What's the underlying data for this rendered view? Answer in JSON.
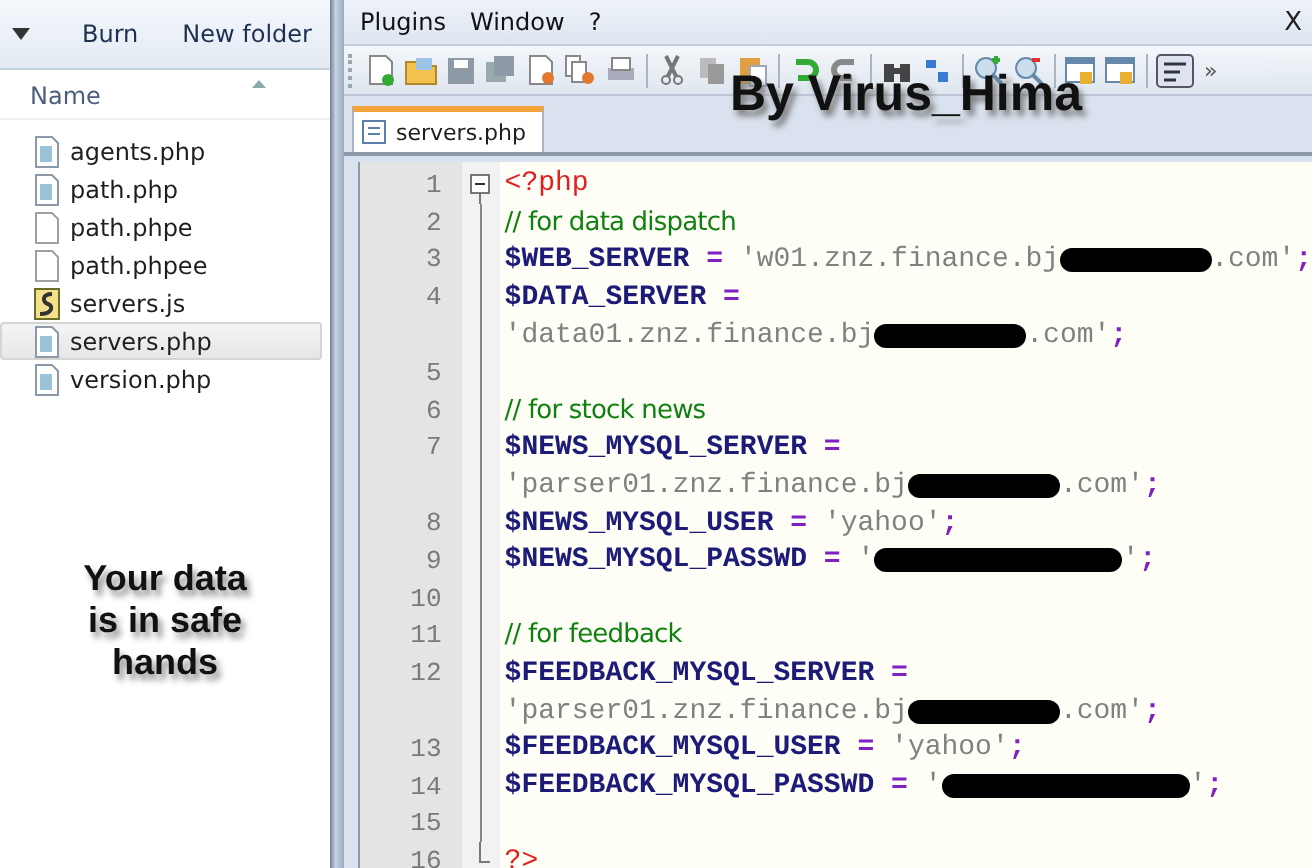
{
  "explorer": {
    "toolbar": [
      "Burn",
      "New folder"
    ],
    "column_header": "Name",
    "files": [
      {
        "name": "agents.php",
        "kind": "php",
        "selected": false
      },
      {
        "name": "path.php",
        "kind": "php",
        "selected": false
      },
      {
        "name": "path.phpe",
        "kind": "blank",
        "selected": false
      },
      {
        "name": "path.phpee",
        "kind": "blank",
        "selected": false
      },
      {
        "name": "servers.js",
        "kind": "script",
        "selected": false
      },
      {
        "name": "servers.php",
        "kind": "php",
        "selected": true
      },
      {
        "name": "version.php",
        "kind": "php",
        "selected": false
      }
    ],
    "caption": "Your data is in safe hands"
  },
  "editor": {
    "menu": [
      "Plugins",
      "Window",
      "?"
    ],
    "close_label": "X",
    "more_label": "»",
    "overlay_caption": "By Virus_Hima",
    "tabs": [
      {
        "label": "servers.php",
        "selected": true
      }
    ],
    "rows": [
      {
        "number": "1",
        "kind": "foldstart",
        "tokens": [
          {
            "kind": "tag",
            "text": "<?php"
          }
        ]
      },
      {
        "number": "2",
        "tokens": [
          {
            "kind": "comment",
            "text": "// for data dispatch"
          }
        ]
      },
      {
        "number": "3",
        "tokens": [
          {
            "kind": "variable",
            "text": "$WEB_SERVER"
          },
          {
            "kind": "operator",
            "text": " = "
          },
          {
            "kind": "string",
            "text": "'w01.znz.finance.bj"
          },
          {
            "kind": "redaction"
          },
          {
            "kind": "string",
            "text": ".com'"
          },
          {
            "kind": "operator",
            "text": ";"
          }
        ]
      },
      {
        "number": "4",
        "tokens": [
          {
            "kind": "variable",
            "text": "$DATA_SERVER"
          },
          {
            "kind": "operator",
            "text": " ="
          }
        ]
      },
      {
        "tokens": [
          {
            "kind": "string",
            "text": "'data01.znz.finance.bj"
          },
          {
            "kind": "redaction"
          },
          {
            "kind": "string",
            "text": ".com'"
          },
          {
            "kind": "operator",
            "text": ";"
          }
        ]
      },
      {
        "number": "5",
        "tokens": []
      },
      {
        "number": "6",
        "tokens": [
          {
            "kind": "comment",
            "text": "// for stock news"
          }
        ]
      },
      {
        "number": "7",
        "tokens": [
          {
            "kind": "variable",
            "text": "$NEWS_MYSQL_SERVER"
          },
          {
            "kind": "operator",
            "text": " ="
          }
        ]
      },
      {
        "tokens": [
          {
            "kind": "string",
            "text": "'parser01.znz.finance.bj"
          },
          {
            "kind": "redaction"
          },
          {
            "kind": "string",
            "text": ".com'"
          },
          {
            "kind": "operator",
            "text": ";"
          }
        ]
      },
      {
        "number": "8",
        "tokens": [
          {
            "kind": "variable",
            "text": "$NEWS_MYSQL_USER"
          },
          {
            "kind": "operator",
            "text": " = "
          },
          {
            "kind": "string",
            "text": "'yahoo'"
          },
          {
            "kind": "operator",
            "text": ";"
          }
        ]
      },
      {
        "number": "9",
        "tokens": [
          {
            "kind": "variable",
            "text": "$NEWS_MYSQL_PASSWD"
          },
          {
            "kind": "operator",
            "text": " = "
          },
          {
            "kind": "string",
            "text": "'"
          },
          {
            "kind": "longredaction"
          },
          {
            "kind": "string",
            "text": "'"
          },
          {
            "kind": "operator",
            "text": ";"
          }
        ]
      },
      {
        "number": "10",
        "tokens": []
      },
      {
        "number": "11",
        "tokens": [
          {
            "kind": "comment",
            "text": "// for feedback"
          }
        ]
      },
      {
        "number": "12",
        "tokens": [
          {
            "kind": "variable",
            "text": "$FEEDBACK_MYSQL_SERVER"
          },
          {
            "kind": "operator",
            "text": " ="
          }
        ]
      },
      {
        "tokens": [
          {
            "kind": "string",
            "text": "'parser01.znz.finance.bj"
          },
          {
            "kind": "redaction"
          },
          {
            "kind": "string",
            "text": ".com'"
          },
          {
            "kind": "operator",
            "text": ";"
          }
        ]
      },
      {
        "number": "13",
        "tokens": [
          {
            "kind": "variable",
            "text": "$FEEDBACK_MYSQL_USER"
          },
          {
            "kind": "operator",
            "text": " = "
          },
          {
            "kind": "string",
            "text": "'yahoo'"
          },
          {
            "kind": "operator",
            "text": ";"
          }
        ]
      },
      {
        "number": "14",
        "tokens": [
          {
            "kind": "variable",
            "text": "$FEEDBACK_MYSQL_PASSWD"
          },
          {
            "kind": "operator",
            "text": " = "
          },
          {
            "kind": "string",
            "text": "'"
          },
          {
            "kind": "longredaction"
          },
          {
            "kind": "string",
            "text": "'"
          },
          {
            "kind": "operator",
            "text": ";"
          }
        ]
      },
      {
        "number": "15",
        "tokens": []
      },
      {
        "number": "16",
        "kind": "foldend",
        "tokens": [
          {
            "kind": "tag",
            "text": "?>"
          }
        ]
      }
    ]
  }
}
